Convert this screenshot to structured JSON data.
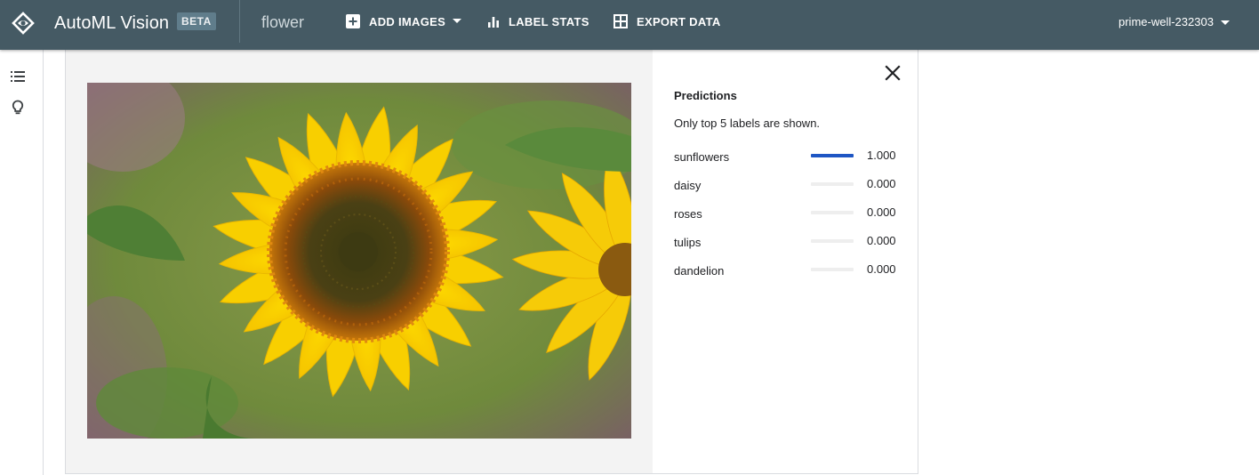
{
  "header": {
    "app_title": "AutoML Vision",
    "badge": "BETA",
    "dataset": "flower",
    "actions": [
      {
        "label": "ADD IMAGES",
        "icon": "add-box-icon",
        "has_dropdown": true
      },
      {
        "label": "LABEL STATS",
        "icon": "bar-chart-icon",
        "has_dropdown": false
      },
      {
        "label": "EXPORT DATA",
        "icon": "grid-icon",
        "has_dropdown": false
      }
    ],
    "project": "prime-well-232303"
  },
  "left_rail": {
    "icons": [
      "list-icon",
      "lightbulb-icon"
    ]
  },
  "image": {
    "subject": "sunflower photo"
  },
  "predictions": {
    "title": "Predictions",
    "note": "Only top 5 labels are shown.",
    "items": [
      {
        "label": "sunflowers",
        "score": "1.000",
        "value": 1.0
      },
      {
        "label": "daisy",
        "score": "0.000",
        "value": 0.0
      },
      {
        "label": "roses",
        "score": "0.000",
        "value": 0.0
      },
      {
        "label": "tulips",
        "score": "0.000",
        "value": 0.0
      },
      {
        "label": "dandelion",
        "score": "0.000",
        "value": 0.0
      }
    ]
  },
  "colors": {
    "appbar": "#455a64",
    "accent": "#1e56c4",
    "bar_track": "#eeeeee",
    "image_bg": "#f3f3f3"
  }
}
